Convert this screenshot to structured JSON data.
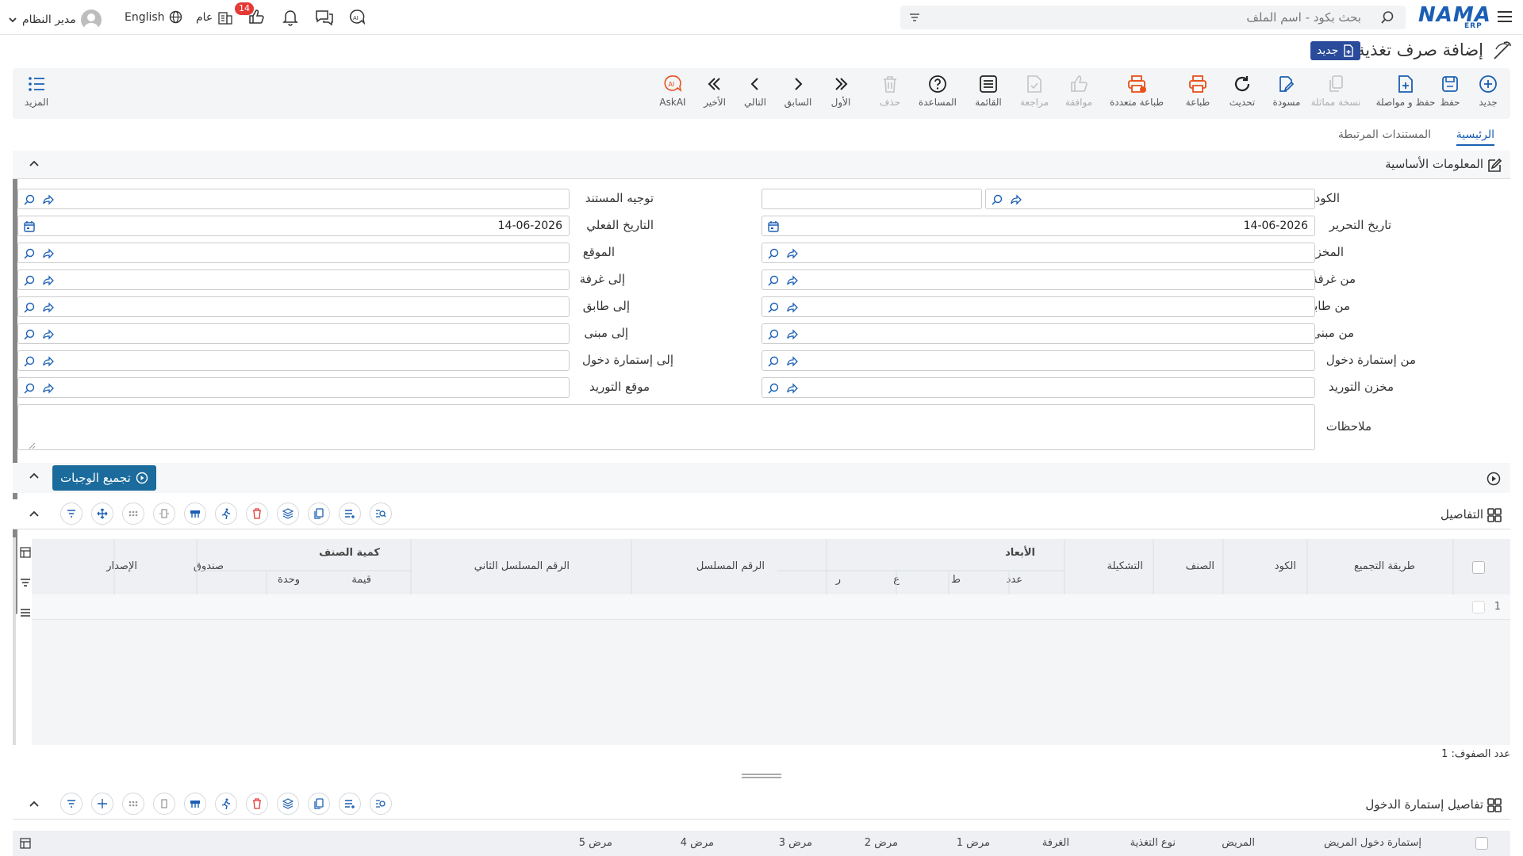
{
  "header": {
    "brand": "NAMA",
    "brand_sub": "ERP",
    "search_placeholder": "بحث بكود - اسم الملف",
    "user_name": "مدير النظام",
    "language": "English",
    "scope": "عام",
    "notifications_count": "14"
  },
  "page": {
    "title": "إضافة صرف تغذية",
    "status_badge": "جديد"
  },
  "toolbar": {
    "new": "جديد",
    "save": "حفظ",
    "save_continue": "حفظ و مواصلة",
    "duplicate": "نسخة مماثلة",
    "draft": "مسودة",
    "refresh": "تحديث",
    "print": "طباعة",
    "multi_print": "طباعة متعددة",
    "approve": "موافقة",
    "review": "مراجعة",
    "list": "القائمة",
    "help": "المساعدة",
    "delete": "حذف",
    "first": "الأول",
    "previous": "السابق",
    "next": "التالي",
    "last": "الأخير",
    "askai": "AskAI",
    "more": "المزيد"
  },
  "tabs": {
    "main": "الرئيسية",
    "related_docs": "المستندات المرتبطة"
  },
  "basic_info": {
    "title": "المعلومات الأساسية",
    "code_label": "الكود",
    "doc_direction_label": "توجيه المستند",
    "edit_date_label": "تاريخ التحرير",
    "edit_date_value": "14-06-2026",
    "actual_date_label": "التاريخ الفعلي",
    "actual_date_value": "14-06-2026",
    "warehouse_label": "المخزن",
    "location_label": "الموقع",
    "from_room_label": "من غرفة",
    "to_room_label": "إلى غرفة",
    "from_floor_label": "من طابق",
    "to_floor_label": "إلى طابق",
    "from_building_label": "من مبنى",
    "to_building_label": "إلى مبنى",
    "from_admission_label": "من إستمارة دخول",
    "to_admission_label": "إلى إستمارة دخول",
    "supply_warehouse_label": "مخزن التوريد",
    "supply_location_label": "موقع التوريد",
    "notes_label": "ملاحظات"
  },
  "actions": {
    "group_meals": "تجميع الوجبات"
  },
  "details": {
    "title": "التفاصيل",
    "columns": {
      "grouping_method": "طريقة التجميع",
      "code": "الكود",
      "item": "الصنف",
      "configuration": "التشكيلة",
      "dimensions": "الأبعاد",
      "count": "عدد",
      "length": "ط",
      "width": "ع",
      "radius": "ر",
      "serial": "الرقم المسلسل",
      "serial2": "الرقم المسلسل الثاني",
      "item_qty": "كمية الصنف",
      "value": "قيمة",
      "unit": "وحدة",
      "box": "صندوق",
      "version": "الإصدار"
    },
    "row_number": "1",
    "row_count": "عدد الصفوف: 1"
  },
  "admission_details": {
    "title": "تفاصيل إستمارة الدخول",
    "columns": [
      "إستمارة دخول المريض",
      "المريض",
      "نوع التغذية",
      "الغرفة",
      "مرض 1",
      "مرض 2",
      "مرض 3",
      "مرض 4",
      "مرض 5"
    ]
  },
  "colors": {
    "brand": "#1a5fb4",
    "badge": "#2a4b9b",
    "group_button": "#1b6b9c",
    "print": "#e8511c",
    "notification": "#e53935"
  }
}
